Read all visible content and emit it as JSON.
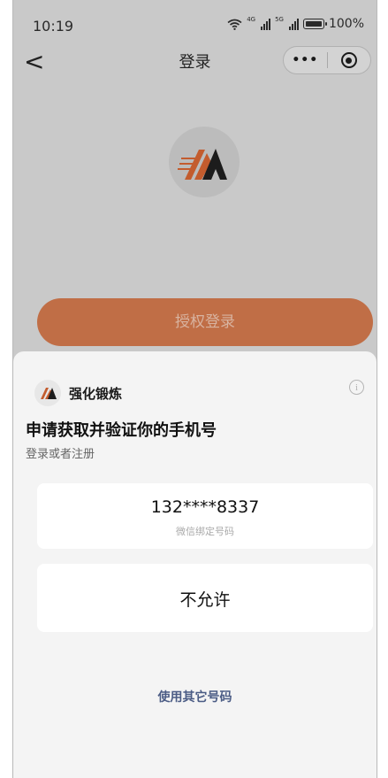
{
  "status_bar": {
    "time": "10:19",
    "network_1": "4G",
    "network_2": "5G",
    "battery": "100%"
  },
  "nav": {
    "back_glyph": "<",
    "title": "登录",
    "more_glyph": "•••"
  },
  "auth_button": {
    "label": "授权登录"
  },
  "sheet": {
    "app_name": "强化锻炼",
    "info_glyph": "i",
    "request_title": "申请获取并验证你的手机号",
    "request_subtitle": "登录或者注册",
    "phone_option": {
      "number": "132****8337",
      "note": "微信绑定号码"
    },
    "deny_label": "不允许",
    "other_number_link": "使用其它号码"
  },
  "colors": {
    "accent_orange": "#c06e46",
    "link_blue": "#4b5c85",
    "overlay_gray": "#c9c9c9",
    "sheet_bg": "#f4f4f4"
  }
}
